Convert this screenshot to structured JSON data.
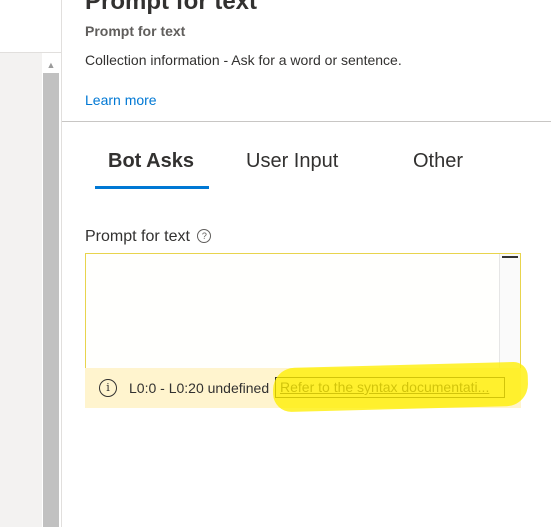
{
  "header": {
    "title": "Prompt for text",
    "subtitle": "Prompt for text",
    "description": "Collection information - Ask for a word or sentence.",
    "learn_more": "Learn more"
  },
  "tabs": [
    {
      "label": "Bot Asks",
      "active": true
    },
    {
      "label": "User Input",
      "active": false
    },
    {
      "label": "Other",
      "active": false
    }
  ],
  "field": {
    "label": "Prompt for text",
    "help_icon": "?",
    "value": ""
  },
  "diagnostic": {
    "info_icon": "i",
    "text": "L0:0 - L0:20 undefined",
    "link": "Refer to the syntax documentati..."
  },
  "colors": {
    "accent": "#0078d4",
    "warning_bg": "#fff4ce",
    "highlight": "#ffee00"
  }
}
